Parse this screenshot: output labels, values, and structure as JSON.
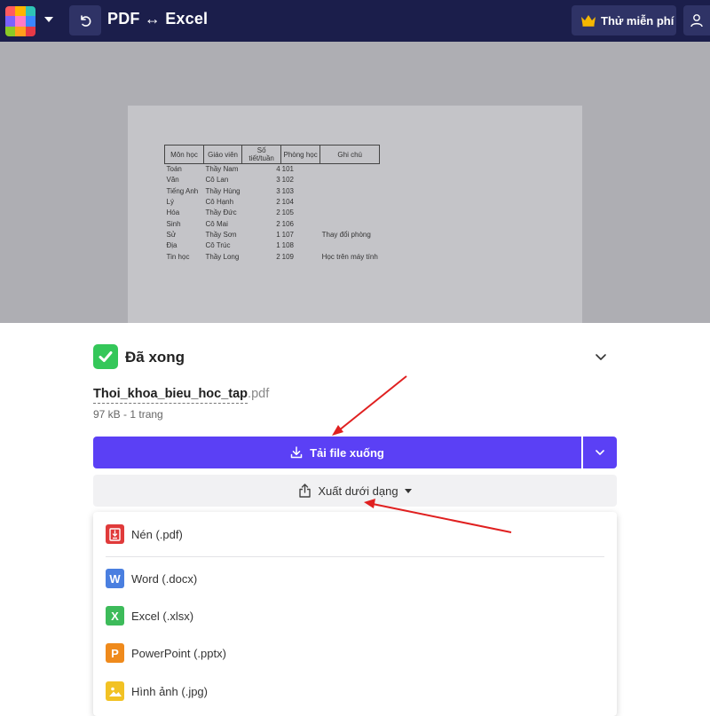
{
  "header": {
    "title": "PDF ↔ Excel",
    "trial_button": "Thử miễn phí",
    "logo_colors": [
      "#ff5a5f",
      "#ffb400",
      "#2ec4b6",
      "#7b61ff",
      "#ff7ac6",
      "#3a86ff",
      "#8ac926",
      "#ff9f1c",
      "#e63946"
    ]
  },
  "preview": {
    "headers": [
      "Môn học",
      "Giáo viên",
      "Số tiết/tuần",
      "Phòng học",
      "Ghi chú"
    ],
    "rows": [
      {
        "subject": "Toán",
        "teacher": "Thầy Nam",
        "periods": "4",
        "room": "101",
        "note": ""
      },
      {
        "subject": "Văn",
        "teacher": "Cô Lan",
        "periods": "3",
        "room": "102",
        "note": ""
      },
      {
        "subject": "Tiếng Anh",
        "teacher": "Thầy Hùng",
        "periods": "3",
        "room": "103",
        "note": ""
      },
      {
        "subject": "Lý",
        "teacher": "Cô Hạnh",
        "periods": "2",
        "room": "104",
        "note": ""
      },
      {
        "subject": "Hóa",
        "teacher": "Thầy Đức",
        "periods": "2",
        "room": "105",
        "note": ""
      },
      {
        "subject": "Sinh",
        "teacher": "Cô Mai",
        "periods": "2",
        "room": "106",
        "note": ""
      },
      {
        "subject": "Sử",
        "teacher": "Thầy Sơn",
        "periods": "1",
        "room": "107",
        "note": "Thay đổi phòng"
      },
      {
        "subject": "Địa",
        "teacher": "Cô Trúc",
        "periods": "1",
        "room": "108",
        "note": ""
      },
      {
        "subject": "Tin học",
        "teacher": "Thầy Long",
        "periods": "2",
        "room": "109",
        "note": "Học trên máy tính"
      }
    ]
  },
  "result": {
    "status": "Đã xong",
    "file_base": "Thoi_khoa_bieu_hoc_tap",
    "file_ext": ".pdf",
    "file_meta": "97 kB - 1 trang",
    "download_label": "Tải file xuống",
    "export_label": "Xuất dưới dạng"
  },
  "export_menu": {
    "items": [
      {
        "label": "Nén (.pdf)",
        "icon": "compress-pdf-icon",
        "color": "#e03a3a",
        "glyph": ""
      },
      {
        "label": "Word (.docx)",
        "icon": "word-icon",
        "color": "#4a7fe0",
        "glyph": "W"
      },
      {
        "label": "Excel (.xlsx)",
        "icon": "excel-icon",
        "color": "#3dbb5a",
        "glyph": "X"
      },
      {
        "label": "PowerPoint (.pptx)",
        "icon": "powerpoint-icon",
        "color": "#ef8a1c",
        "glyph": "P"
      },
      {
        "label": "Hình ảnh (.jpg)",
        "icon": "image-icon",
        "color": "#f2c224",
        "glyph": ""
      }
    ]
  },
  "colors": {
    "topbar": "#1b1e4b",
    "accent": "#5b40f5",
    "success": "#34c759",
    "arrow": "#e02020"
  }
}
